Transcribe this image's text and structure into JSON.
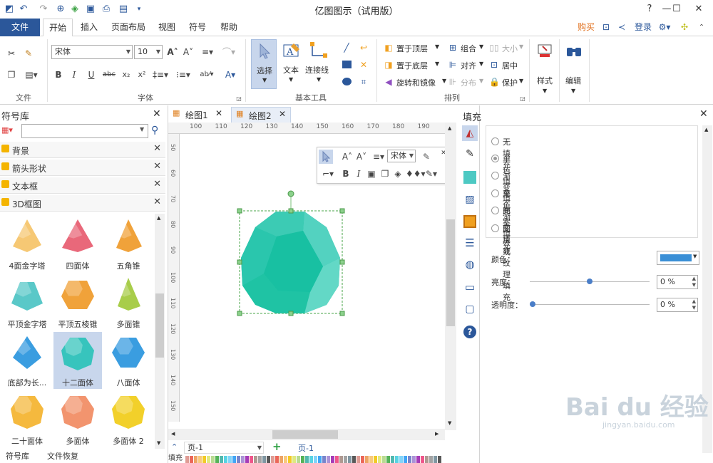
{
  "app": {
    "title": "亿图图示（试用版）"
  },
  "window_controls": {
    "help": "?",
    "minimize": "—",
    "maximize": "☐",
    "close": "✕"
  },
  "menu": {
    "file": "文件",
    "tabs": [
      "开始",
      "插入",
      "页面布局",
      "视图",
      "符号",
      "帮助"
    ],
    "right": {
      "buy": "购买",
      "login": "登录"
    }
  },
  "ribbon": {
    "groups": {
      "file": "文件",
      "font": "字体",
      "basic_tools": "基本工具",
      "arrange": "排列"
    },
    "font": {
      "name": "宋体",
      "size": "10"
    },
    "tools": {
      "select": "选择",
      "text": "文本",
      "connector": "连接线"
    },
    "arrange": {
      "bring_front": "置于顶层",
      "send_back": "置于底层",
      "rotate_mirror": "旋转和镜像",
      "group": "组合",
      "align": "对齐",
      "distribute": "分布",
      "size": "大小",
      "center": "居中",
      "protect": "保护"
    },
    "style": "样式",
    "edit": "编辑"
  },
  "left_panel": {
    "title": "符号库",
    "search_placeholder": "",
    "libraries": [
      "背景",
      "箭头形状",
      "文本框",
      "3D框图"
    ],
    "shapes": [
      {
        "label": "4面金字塔",
        "color": "#f6c874"
      },
      {
        "label": "四面体",
        "color": "#e9687a"
      },
      {
        "label": "五角锥",
        "color": "#f0a23a"
      },
      {
        "label": "平顶金字塔",
        "color": "#5ac8c8"
      },
      {
        "label": "平顶五棱锥",
        "color": "#f0a23a"
      },
      {
        "label": "多面锥",
        "color": "#a8cd4a"
      },
      {
        "label": "底部为长...",
        "color": "#3a9de0"
      },
      {
        "label": "十二面体",
        "color": "#37c4bd"
      },
      {
        "label": "八面体",
        "color": "#3a9de0"
      },
      {
        "label": "二十面体",
        "color": "#f5b93e"
      },
      {
        "label": "多面体",
        "color": "#f2946e"
      },
      {
        "label": "多面体 2",
        "color": "#f2d02a"
      }
    ],
    "bottom_tabs": [
      "符号库",
      "文件恢复"
    ]
  },
  "doc_tabs": [
    {
      "label": "绘图1"
    },
    {
      "label": "绘图2"
    }
  ],
  "ruler": {
    "h": [
      "100",
      "110",
      "120",
      "130",
      "140",
      "150",
      "160",
      "170",
      "180",
      "190"
    ],
    "v": [
      "50",
      "60",
      "70",
      "80",
      "90",
      "100",
      "110",
      "120",
      "130",
      "140",
      "150"
    ]
  },
  "floating_toolbar": {
    "font": "宋体"
  },
  "status": {
    "page_select": "页-1",
    "page_tab": "页-1",
    "fill_label": "填充"
  },
  "right_panel": {
    "title": "填充",
    "options": [
      "无填充",
      "单色填充",
      "渐变填充",
      "单色渐变填充",
      "图案填充",
      "图片或纹理填充"
    ],
    "selected_option": 1,
    "color_label": "颜色：",
    "color_value": "#3a8fd6",
    "brightness_label": "亮度：",
    "brightness_value": "0 %",
    "transparency_label": "透明度：",
    "transparency_value": "0 %"
  },
  "shape_color": "#1fc3a4",
  "accent": "#2b579a",
  "watermark": {
    "brand": "Bai du 经验",
    "url": "jingyan.baidu.com"
  }
}
